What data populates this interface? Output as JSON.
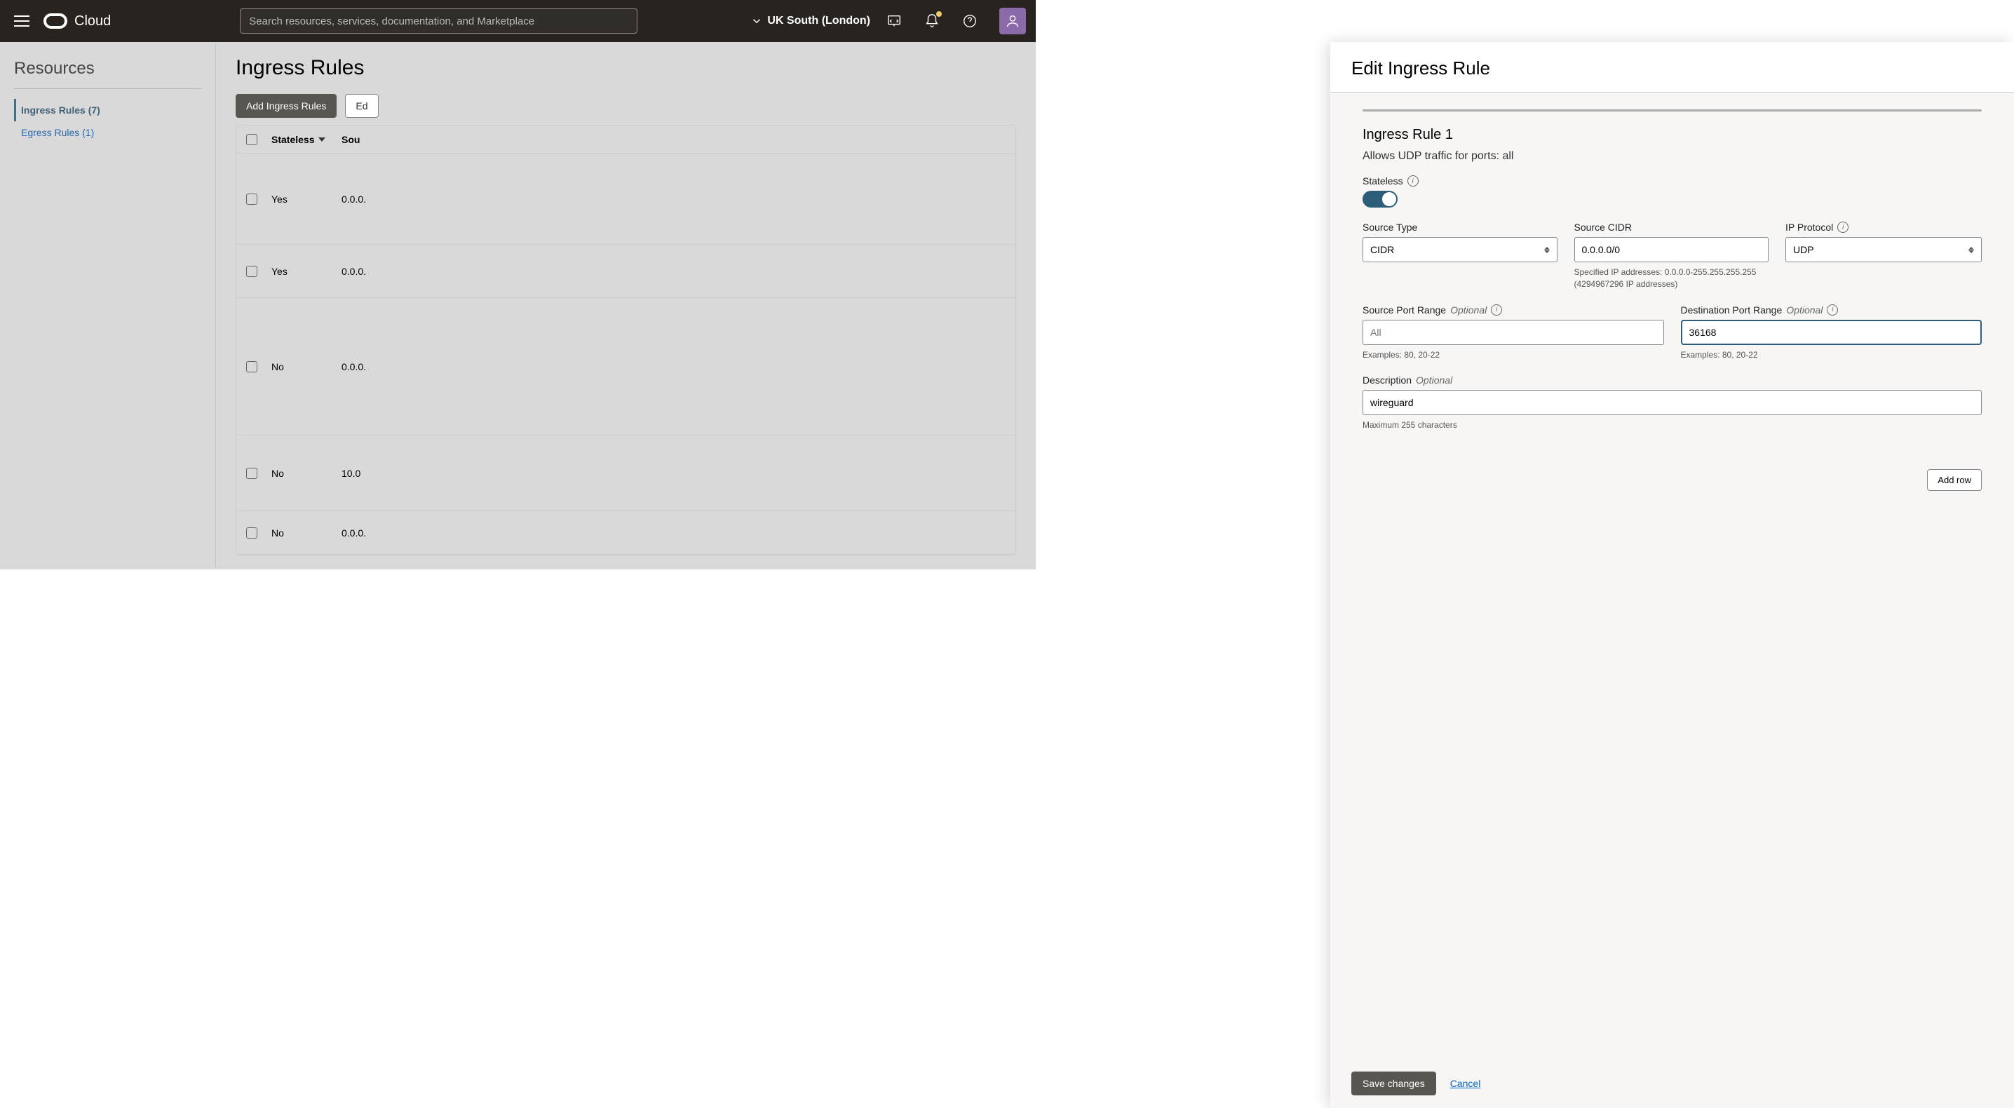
{
  "header": {
    "brand": "Cloud",
    "search_placeholder": "Search resources, services, documentation, and Marketplace",
    "region": "UK South (London)"
  },
  "sidebar": {
    "title": "Resources",
    "items": [
      {
        "label": "Ingress Rules (7)"
      },
      {
        "label": "Egress Rules (1)"
      }
    ]
  },
  "content": {
    "title": "Ingress Rules",
    "add_button": "Add Ingress Rules",
    "edit_button": "Ed",
    "columns": {
      "stateless": "Stateless",
      "source": "Sou"
    },
    "rows": [
      {
        "stateless": "Yes",
        "source": "0.0.0."
      },
      {
        "stateless": "Yes",
        "source": "0.0.0."
      },
      {
        "stateless": "No",
        "source": "0.0.0."
      },
      {
        "stateless": "No",
        "source": "10.0"
      },
      {
        "stateless": "No",
        "source": "0.0.0."
      }
    ]
  },
  "panel": {
    "title": "Edit Ingress Rule",
    "rule_heading": "Ingress Rule 1",
    "rule_desc": "Allows UDP traffic for ports: all",
    "labels": {
      "stateless": "Stateless",
      "source_type": "Source Type",
      "source_cidr": "Source CIDR",
      "ip_protocol": "IP Protocol",
      "src_port": "Source Port Range",
      "dst_port": "Destination Port Range",
      "description": "Description",
      "optional": "Optional"
    },
    "values": {
      "source_type": "CIDR",
      "source_cidr": "0.0.0.0/0",
      "ip_protocol": "UDP",
      "src_port": "",
      "src_port_placeholder": "All",
      "dst_port": "36168",
      "description": "wireguard"
    },
    "helpers": {
      "cidr_help": "Specified IP addresses: 0.0.0.0-255.255.255.255 (4294967296 IP addresses)",
      "port_examples": "Examples: 80, 20-22",
      "desc_help": "Maximum 255 characters"
    },
    "add_row": "Add row",
    "save": "Save changes",
    "cancel": "Cancel"
  }
}
